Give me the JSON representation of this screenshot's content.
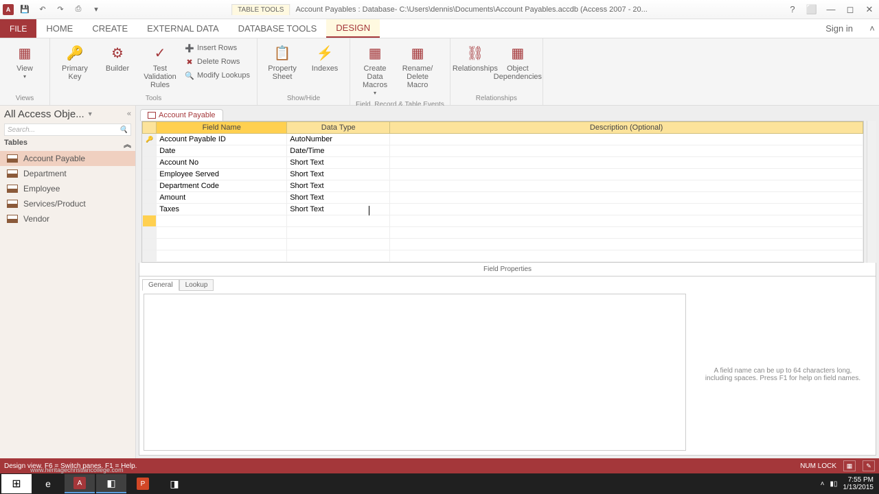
{
  "titlebar": {
    "context_label": "TABLE TOOLS",
    "title": "Account Payables : Database- C:\\Users\\dennis\\Documents\\Account Payables.accdb (Access 2007 - 20..."
  },
  "tabs": {
    "file": "FILE",
    "items": [
      "HOME",
      "CREATE",
      "EXTERNAL DATA",
      "DATABASE TOOLS",
      "DESIGN"
    ],
    "signin": "Sign in"
  },
  "ribbon": {
    "views": {
      "view": "View",
      "primary_key": "Primary Key",
      "builder": "Builder",
      "test": "Test Validation Rules",
      "label": "Views"
    },
    "tools": {
      "insert": "Insert Rows",
      "delete": "Delete Rows",
      "modify": "Modify Lookups",
      "label": "Tools"
    },
    "showhide": {
      "property": "Property Sheet",
      "indexes": "Indexes",
      "label": "Show/Hide"
    },
    "events": {
      "create": "Create Data Macros",
      "rename": "Rename/ Delete Macro",
      "label": "Field, Record & Table Events"
    },
    "rel": {
      "relationships": "Relationships",
      "deps": "Object Dependencies",
      "label": "Relationships"
    }
  },
  "nav": {
    "title": "All Access Obje...",
    "search": "Search...",
    "group": "Tables",
    "items": [
      "Account Payable",
      "Department",
      "Employee",
      "Services/Product",
      "Vendor"
    ]
  },
  "doc_tab": "Account Payable",
  "grid": {
    "headers": {
      "field": "Field Name",
      "type": "Data Type",
      "desc": "Description (Optional)"
    },
    "rows": [
      {
        "field": "Account Payable ID",
        "type": "AutoNumber",
        "key": true
      },
      {
        "field": "Date",
        "type": "Date/Time"
      },
      {
        "field": "Account No",
        "type": "Short Text"
      },
      {
        "field": "Employee Served",
        "type": "Short Text"
      },
      {
        "field": "Department Code",
        "type": "Short Text"
      },
      {
        "field": "Amount",
        "type": "Short Text"
      },
      {
        "field": "Taxes",
        "type": "Short Text"
      }
    ]
  },
  "fp": {
    "label": "Field Properties",
    "general": "General",
    "lookup": "Lookup",
    "help": "A field name can be up to 64 characters long, including spaces. Press F1 for help on field names."
  },
  "status": {
    "left": "Design view.  F6 = Switch panes.  F1 = Help.",
    "numlock": "NUM LOCK"
  },
  "watermark": "www.heritagechristiancollege.com",
  "tray": {
    "time": "7:55 PM",
    "date": "1/13/2015"
  }
}
